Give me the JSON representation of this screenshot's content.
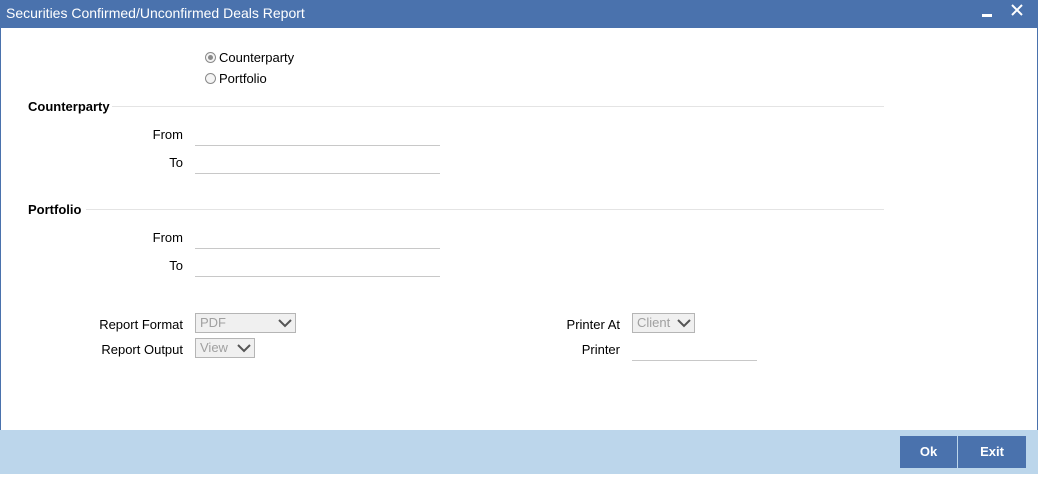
{
  "window": {
    "title": "Securities Confirmed/Unconfirmed Deals Report"
  },
  "selection": {
    "options": [
      {
        "label": "Counterparty",
        "checked": true
      },
      {
        "label": "Portfolio",
        "checked": false
      }
    ]
  },
  "counterparty": {
    "title": "Counterparty",
    "from_label": "From",
    "from_value": "",
    "to_label": "To",
    "to_value": ""
  },
  "portfolio": {
    "title": "Portfolio",
    "from_label": "From",
    "from_value": "",
    "to_label": "To",
    "to_value": ""
  },
  "report": {
    "format_label": "Report Format",
    "format_value": "PDF",
    "output_label": "Report Output",
    "output_value": "View",
    "printer_at_label": "Printer At",
    "printer_at_value": "Client",
    "printer_label": "Printer",
    "printer_value": ""
  },
  "footer": {
    "ok_label": "Ok",
    "exit_label": "Exit"
  },
  "colors": {
    "titlebar": "#4a72ad",
    "footer": "#bcd6eb",
    "button": "#4a72ad"
  },
  "icons": {
    "minimize": "minimize-icon",
    "close": "close-icon",
    "dropdown": "chevron-down-icon"
  }
}
